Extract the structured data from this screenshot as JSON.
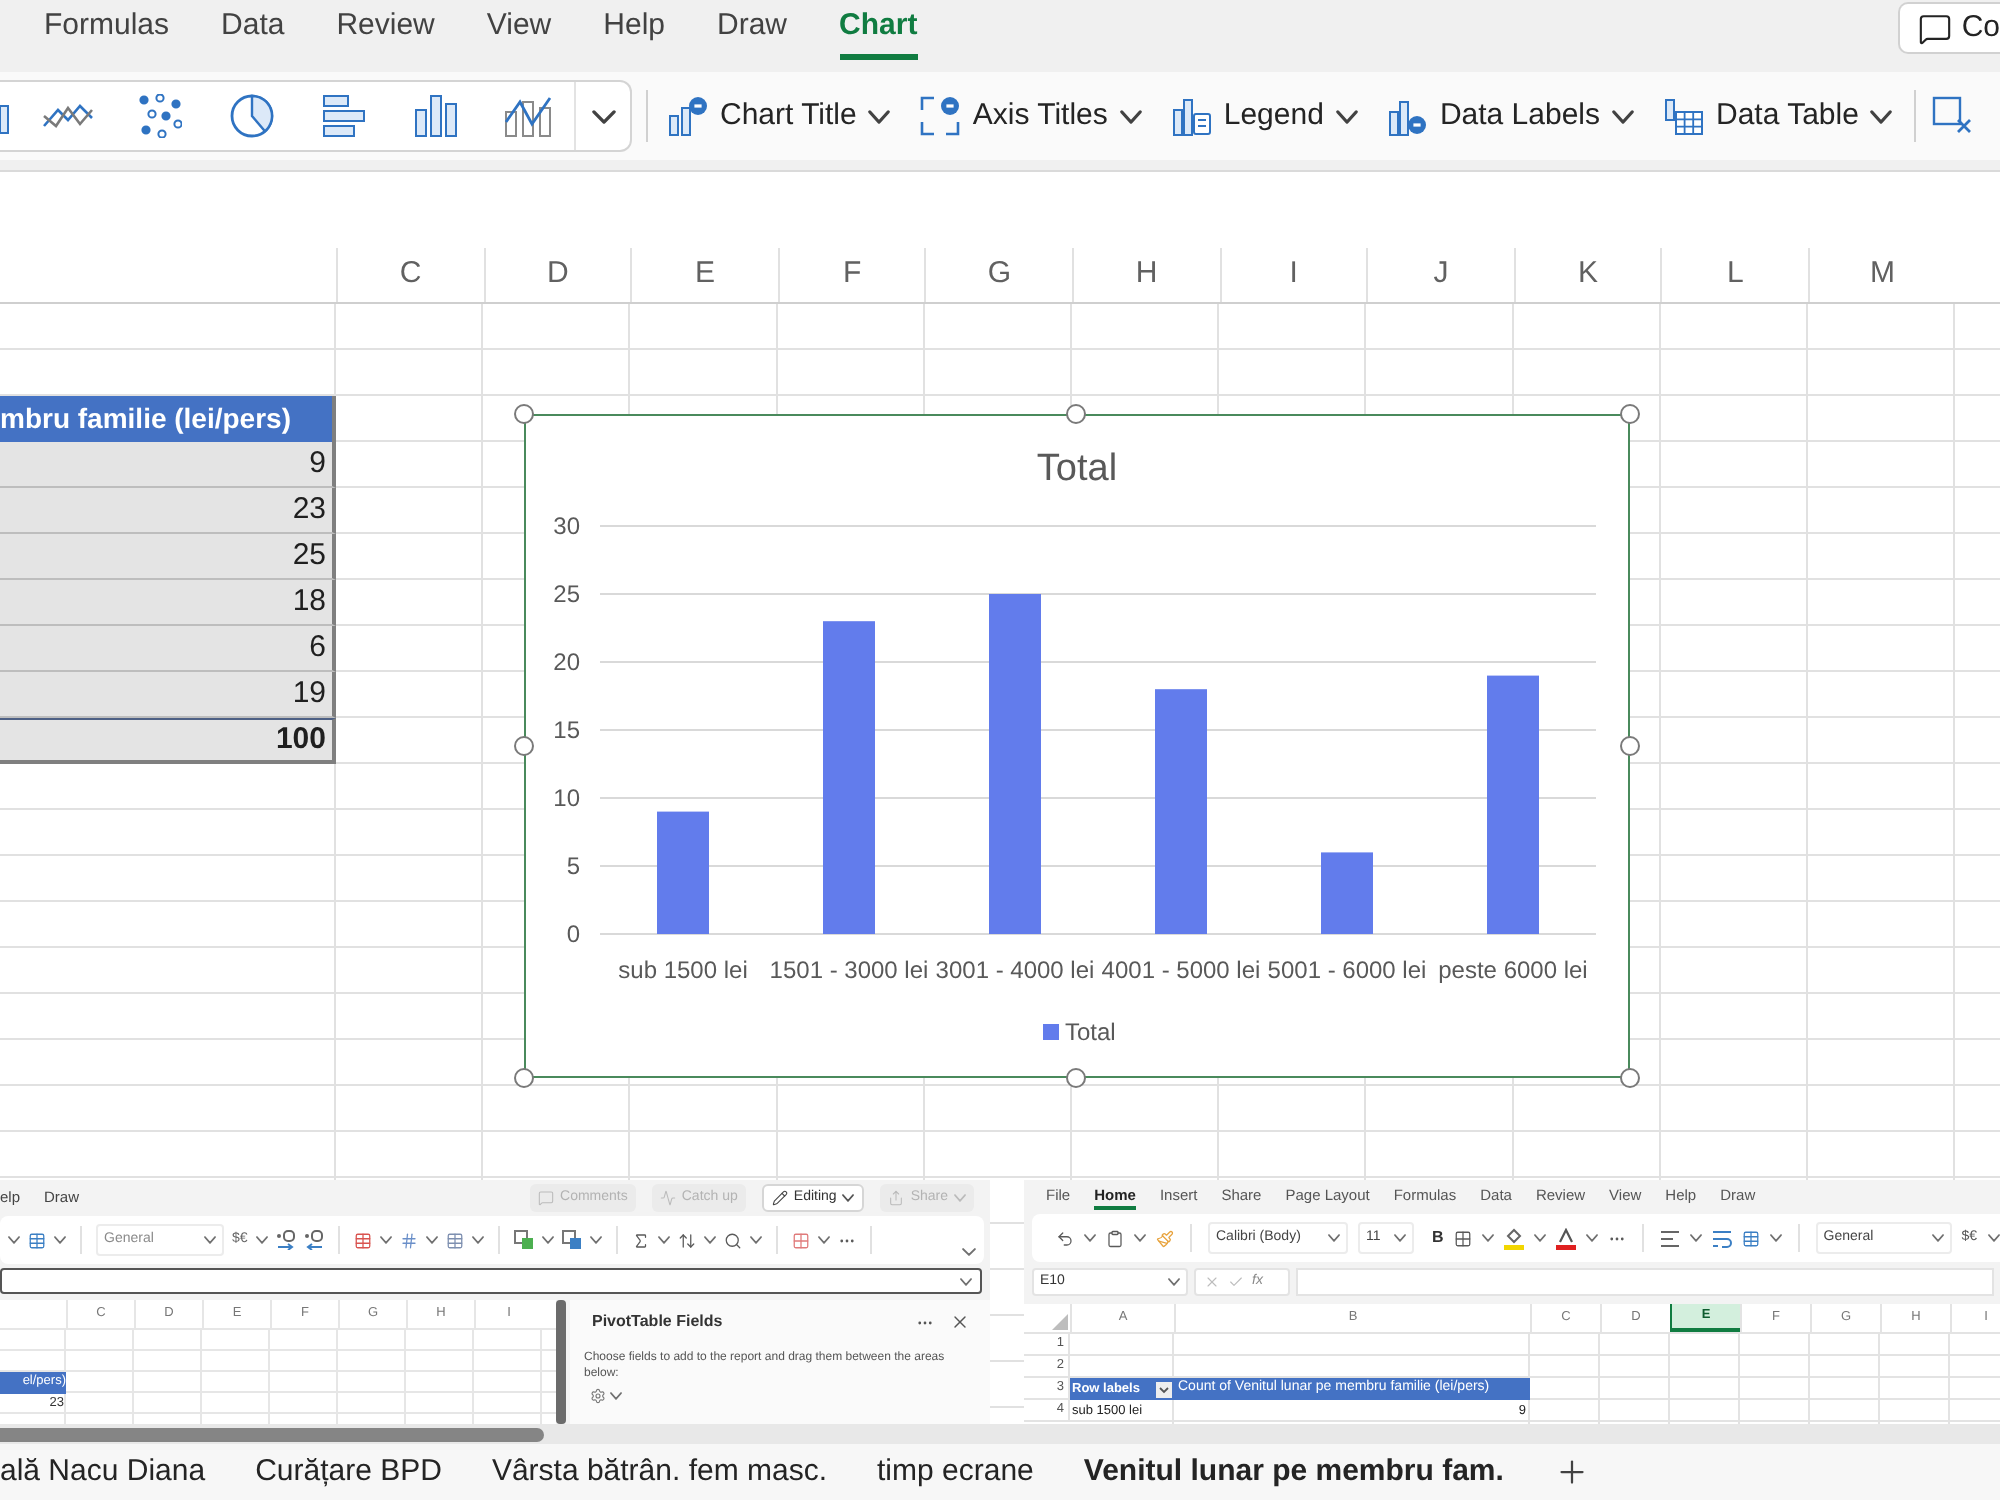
{
  "menu_tabs": [
    {
      "label": "Formulas",
      "selected": false
    },
    {
      "label": "Data",
      "selected": false
    },
    {
      "label": "Review",
      "selected": false
    },
    {
      "label": "View",
      "selected": false
    },
    {
      "label": "Help",
      "selected": false
    },
    {
      "label": "Draw",
      "selected": false
    },
    {
      "label": "Chart",
      "selected": true
    }
  ],
  "comments_button": {
    "label": "Co"
  },
  "ribbon": {
    "buttons": [
      {
        "label": "Chart Title"
      },
      {
        "label": "Axis Titles"
      },
      {
        "label": "Legend"
      },
      {
        "label": "Data Labels"
      },
      {
        "label": "Data Table"
      }
    ]
  },
  "sheet": {
    "columns": [
      "C",
      "D",
      "E",
      "F",
      "G",
      "H",
      "I",
      "J",
      "K",
      "L",
      "M"
    ],
    "table": {
      "header": "mbru familie (lei/pers)",
      "values": [
        "9",
        "23",
        "25",
        "18",
        "6",
        "19"
      ],
      "total": "100"
    }
  },
  "chart": {
    "selected": true,
    "chart_data": {
      "type": "bar",
      "title": "Total",
      "categories": [
        "sub 1500 lei",
        "1501 - 3000 lei",
        "3001 - 4000 lei",
        "4001 - 5000 lei",
        "5001 - 6000 lei",
        "peste 6000 lei"
      ],
      "series": [
        {
          "name": "Total",
          "color": "#627cec",
          "values": [
            9,
            23,
            25,
            18,
            6,
            19
          ]
        }
      ],
      "ylim": [
        0,
        30
      ],
      "yticks": [
        0,
        5,
        10,
        15,
        20,
        25,
        30
      ],
      "grid": true
    }
  },
  "pivot_screenshot": {
    "menu": [
      "elp",
      "Draw"
    ],
    "top_buttons": [
      {
        "label": "Comments",
        "disabled": true
      },
      {
        "label": "Catch up",
        "disabled": true
      },
      {
        "label": "Editing",
        "disabled": false
      },
      {
        "label": "Share",
        "disabled": true
      }
    ],
    "number_format": "General",
    "currency": "$€",
    "columns": [
      "C",
      "D",
      "E",
      "F",
      "G",
      "H",
      "I"
    ],
    "header_cell": "el/pers)",
    "value_cell": "23",
    "pane": {
      "title": "PivotTable Fields",
      "description": "Choose fields to add to the report and drag them between the areas below:"
    }
  },
  "ribbon_screenshot": {
    "menu": [
      {
        "label": "File",
        "selected": false
      },
      {
        "label": "Home",
        "selected": true
      },
      {
        "label": "Insert",
        "selected": false
      },
      {
        "label": "Share",
        "selected": false
      },
      {
        "label": "Page Layout",
        "selected": false
      },
      {
        "label": "Formulas",
        "selected": false
      },
      {
        "label": "Data",
        "selected": false
      },
      {
        "label": "Review",
        "selected": false
      },
      {
        "label": "View",
        "selected": false
      },
      {
        "label": "Help",
        "selected": false
      },
      {
        "label": "Draw",
        "selected": false
      }
    ],
    "font": "Calibri (Body)",
    "font_size": "11",
    "bold_label": "B",
    "number_format": "General",
    "currency": "$€",
    "name_box": "E10",
    "formula_label": "fx",
    "columns": [
      {
        "label": "A",
        "selected": false
      },
      {
        "label": "B",
        "selected": false
      },
      {
        "label": "C",
        "selected": false
      },
      {
        "label": "D",
        "selected": false
      },
      {
        "label": "E",
        "selected": true
      },
      {
        "label": "F",
        "selected": false
      },
      {
        "label": "G",
        "selected": false
      },
      {
        "label": "H",
        "selected": false
      },
      {
        "label": "I",
        "selected": false
      }
    ],
    "row_numbers": [
      "1",
      "2",
      "3",
      "4"
    ],
    "pivot_header": [
      "Row labels",
      "Count of Venitul lunar pe membru familie (lei/pers)"
    ],
    "pivot_row": [
      "sub 1500 lei",
      "9"
    ]
  },
  "sheet_tabs": [
    {
      "label": "ală Nacu Diana",
      "selected": false
    },
    {
      "label": "Curățare BPD",
      "selected": false
    },
    {
      "label": "Vârsta bătrân. fem masc.",
      "selected": false
    },
    {
      "label": "timp ecrane",
      "selected": false
    },
    {
      "label": "Venitul lunar pe membru fam.",
      "selected": true
    }
  ]
}
